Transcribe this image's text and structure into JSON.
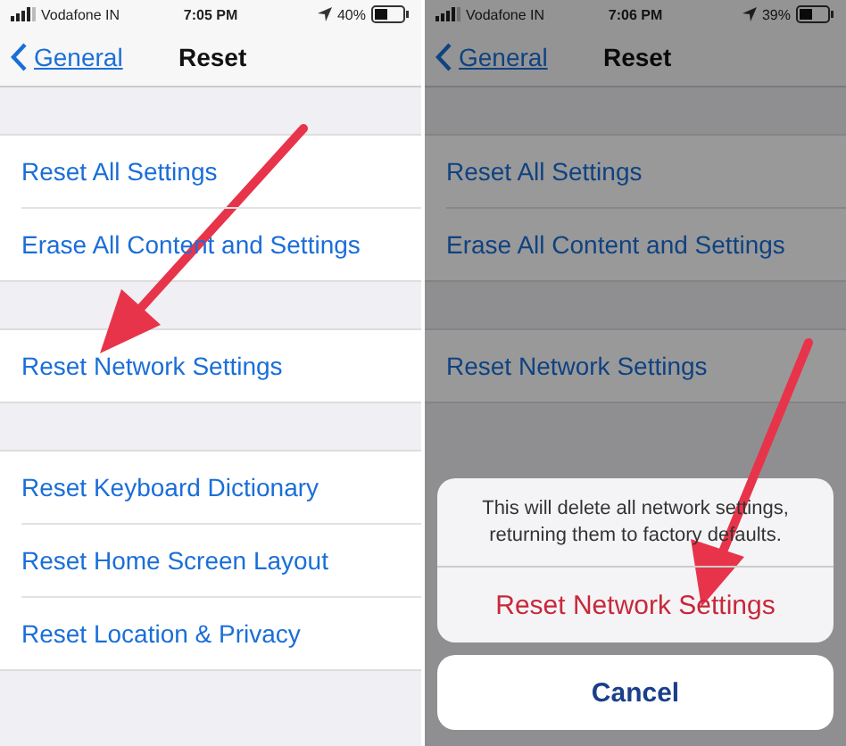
{
  "screens": [
    {
      "status_bar": {
        "carrier": "Vodafone IN",
        "time": "7:05 PM",
        "battery": "40%"
      },
      "nav": {
        "back": "General",
        "title": "Reset"
      },
      "dimmed": false,
      "groups": [
        [
          "Reset All Settings",
          "Erase All Content and Settings"
        ],
        [
          "Reset Network Settings"
        ],
        [
          "Reset Keyboard Dictionary",
          "Reset Home Screen Layout",
          "Reset Location & Privacy"
        ]
      ]
    },
    {
      "status_bar": {
        "carrier": "Vodafone IN",
        "time": "7:06 PM",
        "battery": "39%"
      },
      "nav": {
        "back": "General",
        "title": "Reset"
      },
      "dimmed": true,
      "groups": [
        [
          "Reset All Settings",
          "Erase All Content and Settings"
        ],
        [
          "Reset Network Settings"
        ]
      ],
      "action_sheet": {
        "message": "This will delete all network settings, returning them to factory defaults.",
        "action": "Reset Network Settings",
        "cancel": "Cancel"
      }
    }
  ]
}
